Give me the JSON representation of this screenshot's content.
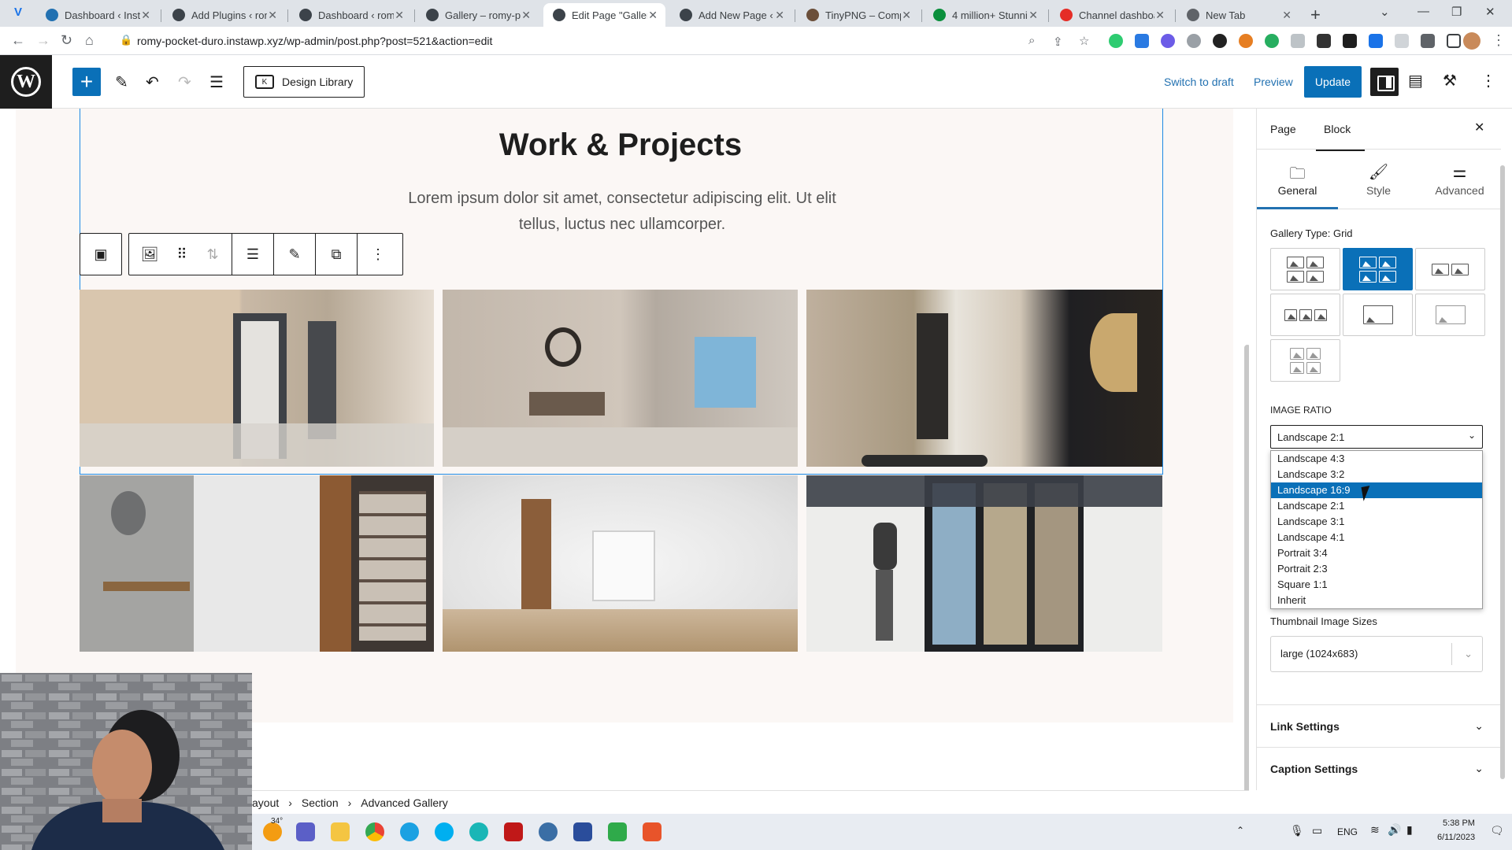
{
  "browser": {
    "tabs": [
      {
        "title": "Dashboard ‹ Insta",
        "favicon_color": "#2271b1"
      },
      {
        "title": "Add Plugins ‹ rom",
        "favicon_color": "#3c434a"
      },
      {
        "title": "Dashboard ‹ romy",
        "favicon_color": "#3c434a"
      },
      {
        "title": "Gallery – romy-po",
        "favicon_color": "#3c434a"
      },
      {
        "title": "Edit Page \"Gallery",
        "favicon_color": "#3c434a"
      },
      {
        "title": "Add New Page ‹ r",
        "favicon_color": "#3c434a"
      },
      {
        "title": "TinyPNG – Comp",
        "favicon_color": "#6b4f3a"
      },
      {
        "title": "4 million+ Stunni",
        "favicon_color": "#0a8f3c"
      },
      {
        "title": "Channel dashboa",
        "favicon_color": "#e52d27"
      },
      {
        "title": "New Tab",
        "favicon_color": "#5f6368"
      }
    ],
    "active_tab_index": 4,
    "url": "romy-pocket-duro.instawp.xyz/wp-admin/post.php?post=521&action=edit"
  },
  "editor_header": {
    "design_library_label": "Design Library",
    "switch_to_draft": "Switch to draft",
    "preview": "Preview",
    "update": "Update"
  },
  "canvas": {
    "title": "Work & Projects",
    "intro": "Lorem ipsum dolor sit amet, consectetur adipiscing elit. Ut elit tellus, luctus nec ullamcorper."
  },
  "breadcrumb": [
    "ayout",
    "Section",
    "Advanced Gallery"
  ],
  "sidebar": {
    "tabs": [
      "Page",
      "Block"
    ],
    "active_tab": "Block",
    "subtabs": [
      {
        "label": "General",
        "icon": "folder-icon"
      },
      {
        "label": "Style",
        "icon": "brush-icon"
      },
      {
        "label": "Advanced",
        "icon": "sliders-icon"
      }
    ],
    "gallery_type_label": "Gallery Type: Grid",
    "image_ratio_label": "IMAGE RATIO",
    "image_ratio_value": "Landscape 2:1",
    "ratio_options": [
      "Landscape 4:3",
      "Landscape 3:2",
      "Landscape 16:9",
      "Landscape 2:1",
      "Landscape 3:1",
      "Landscape 4:1",
      "Portrait 3:4",
      "Portrait 2:3",
      "Square 1:1",
      "Inherit"
    ],
    "highlighted_option": "Landscape 16:9",
    "thumbnail_sizes_label": "Thumbnail Image Sizes",
    "thumbnail_sizes_value": "large (1024x683)",
    "link_settings": "Link Settings",
    "caption_settings": "Caption Settings"
  },
  "taskbar": {
    "weather": "34°",
    "language": "ENG",
    "time": "5:38 PM",
    "date": "6/11/2023"
  },
  "colors": {
    "accent": "#0a70b8",
    "link": "#2271b1",
    "selection_outline": "#1d89e4",
    "section_bg": "#fbf7f5"
  }
}
